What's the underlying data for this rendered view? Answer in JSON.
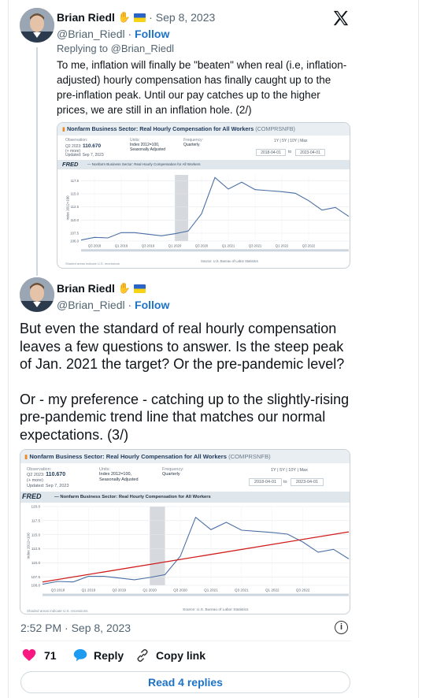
{
  "tweet1": {
    "author": "Brian Riedl",
    "date": "Sep 8, 2023",
    "handle": "@Brian_Riedl",
    "follow_label": "Follow",
    "replying_prefix": "Replying to ",
    "replying_handle": "@Brian_Riedl",
    "text": "To me, inflation will finally be \"beaten\" when real (i.e, inflation-adjusted) hourly compensation has finally caught up to the pre-inflation peak. Until our pay catches up to the higher prices, we are still in an inflation hole. (2/)"
  },
  "tweet2": {
    "author": "Brian Riedl",
    "handle": "@Brian_Riedl",
    "follow_label": "Follow",
    "text_p1": "But even the standard of real hourly compensation leaves a few questions to answer. Is the steep peak of Jan. 2021 the target? Or the pre-pandemic level?",
    "text_p2": "Or - my preference - catching up to the slightly-rising pre-pandemic trend line that matches our normal expectations. (3/)"
  },
  "charts": {
    "title": "Nonfarm Business Sector: Real Hourly Compensation for All Workers",
    "title_suffix": "(COMPRSNFB)",
    "obs_label": "Observation:",
    "obs_period": "Q2 2023:",
    "obs_value": "110.670",
    "obs_more": "(+ more)",
    "obs_updated": "Updated: Sep 7, 2023",
    "units_label": "Units:",
    "units_value": "Index 2012=100,",
    "units_adj": "Seasonally Adjusted",
    "freq_label": "Frequency:",
    "freq_value": "Quarterly",
    "range_1y": "1Y",
    "range_5y": "5Y",
    "range_10y": "10Y",
    "range_max": "Max",
    "date_from": "2018-04-01",
    "date_to": "2023-04-01",
    "date_sep": "to",
    "fred": "FRED",
    "legend": "— Nonfarm Business Sector: Real Hourly Compensation for All Workers",
    "ylabel": "Index 2012=100",
    "source": "Source: U.S. Bureau of Labor Statistics",
    "shade_note": "Shaded areas indicate U.S. recessions"
  },
  "chart_data": [
    {
      "type": "line",
      "title": "Nonfarm Business Sector: Real Hourly Compensation for All Workers",
      "ylabel": "Index 2012=100",
      "x": [
        "Q2 2018",
        "Q3 2018",
        "Q4 2018",
        "Q1 2019",
        "Q2 2019",
        "Q3 2019",
        "Q4 2019",
        "Q1 2020",
        "Q2 2020",
        "Q3 2020",
        "Q4 2020",
        "Q1 2021",
        "Q2 2021",
        "Q3 2021",
        "Q4 2021",
        "Q1 2022",
        "Q2 2022",
        "Q3 2022",
        "Q4 2022",
        "Q1 2023",
        "Q2 2023"
      ],
      "x_ticks": [
        "Q3 2018",
        "Q1 2019",
        "Q3 2019",
        "Q1 2020",
        "Q3 2020",
        "Q1 2021",
        "Q3 2021",
        "Q1 2022",
        "Q3 2022"
      ],
      "y_ticks": [
        106.0,
        107.5,
        110.0,
        112.5,
        115.0,
        117.5
      ],
      "ylim": [
        106.0,
        118.6
      ],
      "series": [
        {
          "values": [
            106.2,
            106.7,
            106.6,
            107.6,
            107.6,
            107.3,
            107.0,
            107.4,
            107.9,
            111.2,
            118.1,
            115.9,
            117.2,
            115.8,
            115.6,
            115.4,
            115.1,
            113.7,
            111.9,
            112.4,
            110.7
          ]
        }
      ],
      "recession": [
        "Q1 2020",
        "Q2 2020"
      ],
      "grid": true
    },
    {
      "type": "line",
      "title": "Nonfarm Business Sector: Real Hourly Compensation for All Workers",
      "ylabel": "Index 2012=100",
      "x": [
        "Q2 2018",
        "Q3 2018",
        "Q4 2018",
        "Q1 2019",
        "Q2 2019",
        "Q3 2019",
        "Q4 2019",
        "Q1 2020",
        "Q2 2020",
        "Q3 2020",
        "Q4 2020",
        "Q1 2021",
        "Q2 2021",
        "Q3 2021",
        "Q4 2021",
        "Q1 2022",
        "Q2 2022",
        "Q3 2022",
        "Q4 2022",
        "Q1 2023",
        "Q2 2023"
      ],
      "x_ticks": [
        "Q3 2018",
        "Q1 2019",
        "Q3 2019",
        "Q1 2020",
        "Q3 2020",
        "Q1 2021",
        "Q3 2021",
        "Q1 2022",
        "Q3 2022"
      ],
      "y_ticks": [
        106.0,
        107.5,
        110.0,
        112.5,
        115.0,
        117.5,
        120.0
      ],
      "ylim": [
        106.0,
        120.0
      ],
      "series": [
        {
          "values": [
            106.2,
            106.7,
            106.6,
            107.6,
            107.6,
            107.3,
            107.0,
            107.4,
            107.9,
            111.2,
            118.1,
            115.9,
            117.2,
            115.8,
            115.6,
            115.4,
            115.1,
            113.7,
            111.9,
            112.4,
            110.7
          ]
        },
        {
          "style": "trend-line",
          "values_at_ends": [
            106.6,
            115.5
          ]
        }
      ],
      "recession": [
        "Q1 2020",
        "Q2 2020"
      ],
      "grid": true
    }
  ],
  "footer": {
    "timestamp": "2:52 PM · Sep 8, 2023",
    "likes": "71",
    "reply_label": "Reply",
    "copy_label": "Copy link",
    "read_replies": "Read 4 replies"
  },
  "colors": {
    "series": "#4a6fa5",
    "trend": "#d01c1c",
    "link": "#1d73c7",
    "heart": "#f91880",
    "recession": "#d6d9dd"
  }
}
